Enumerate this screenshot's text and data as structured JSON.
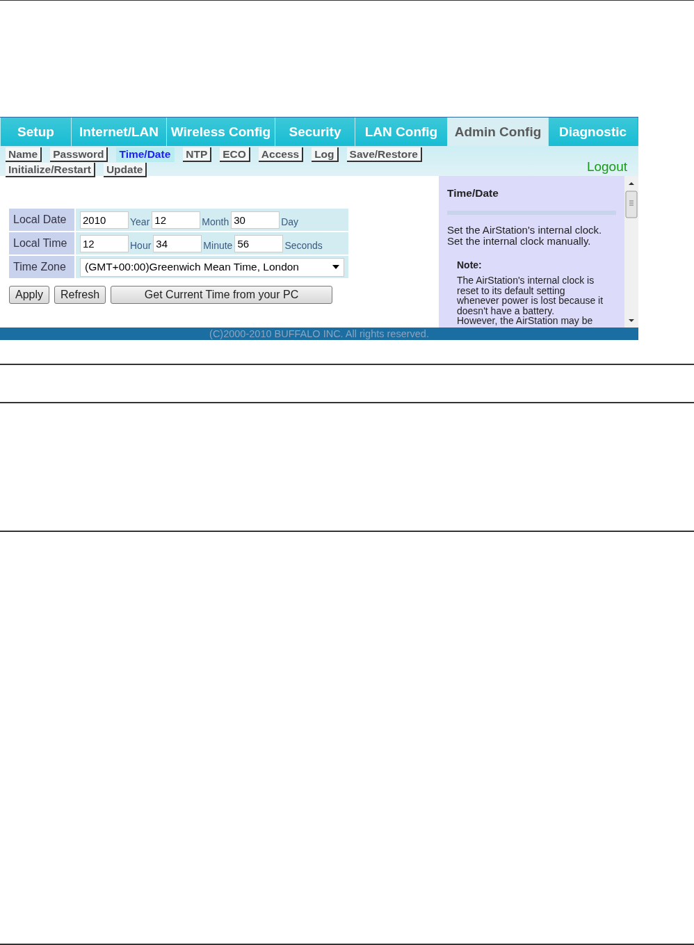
{
  "tabs": [
    {
      "label": "Setup",
      "selected": false
    },
    {
      "label": "Internet/LAN",
      "selected": false
    },
    {
      "label": "Wireless Config",
      "selected": false
    },
    {
      "label": "Security",
      "selected": false
    },
    {
      "label": "LAN Config",
      "selected": false
    },
    {
      "label": "Admin Config",
      "selected": true
    },
    {
      "label": "Diagnostic",
      "selected": false
    }
  ],
  "subtabs": [
    {
      "label": "Name",
      "selected": false
    },
    {
      "label": "Password",
      "selected": false
    },
    {
      "label": "Time/Date",
      "selected": true
    },
    {
      "label": "NTP",
      "selected": false
    },
    {
      "label": "ECO",
      "selected": false
    },
    {
      "label": "Access",
      "selected": false
    },
    {
      "label": "Log",
      "selected": false
    },
    {
      "label": "Save/Restore",
      "selected": false
    },
    {
      "label": "Initialize/Restart",
      "selected": false
    },
    {
      "label": "Update",
      "selected": false
    }
  ],
  "logout": "Logout",
  "form": {
    "rows": [
      {
        "kind": "inputs",
        "label": "Local Date",
        "fields": [
          {
            "value": "2010",
            "unit": "Year"
          },
          {
            "value": "12",
            "unit": "Month"
          },
          {
            "value": "30",
            "unit": "Day"
          }
        ]
      },
      {
        "kind": "inputs",
        "label": "Local Time",
        "fields": [
          {
            "value": "12",
            "unit": "Hour"
          },
          {
            "value": "34",
            "unit": "Minute"
          },
          {
            "value": "56",
            "unit": "Seconds"
          }
        ]
      },
      {
        "kind": "select",
        "label": "Time Zone",
        "value": "(GMT+00:00)Greenwich Mean Time, London"
      }
    ],
    "buttons": [
      "Apply",
      "Refresh",
      "Get Current Time from your PC"
    ]
  },
  "help": {
    "title": "Time/Date",
    "paragraphs": [
      "Set the AirStation's internal clock.",
      "Set the internal clock manually."
    ],
    "note_title": "Note:",
    "note_lines": [
      "The AirStation's internal clock is",
      "reset to its default setting",
      "whenever power is lost because it",
      "doesn't have a battery.",
      "However, the AirStation may be"
    ]
  },
  "footer": "(C)2000-2010 BUFFALO INC. All rights reserved."
}
